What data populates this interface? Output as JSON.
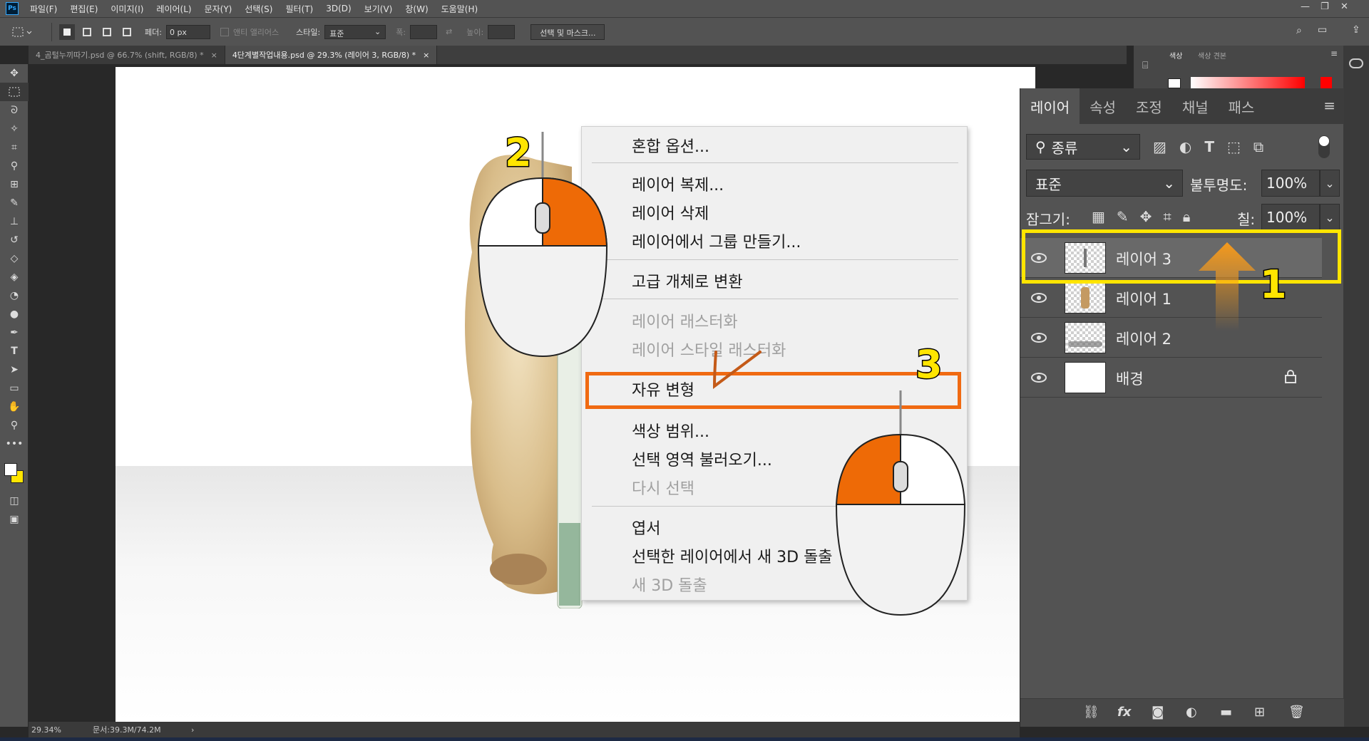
{
  "menubar": {
    "app_icon": "Ps",
    "items": [
      "파일(F)",
      "편집(E)",
      "이미지(I)",
      "레이어(L)",
      "문자(Y)",
      "선택(S)",
      "필터(T)",
      "3D(D)",
      "보기(V)",
      "창(W)",
      "도움말(H)"
    ]
  },
  "options": {
    "feather_label": "페더:",
    "feather_value": "0 px",
    "antialias_label": "앤티 앨리어스",
    "style_label": "스타일:",
    "style_value": "표준",
    "width_label": "폭:",
    "height_label": "높이:",
    "select_mask_button": "선택 및 마스크..."
  },
  "tabs": [
    {
      "label": "4_곰털누끼따기.psd @ 66.7% (shift, RGB/8) *",
      "close": "×"
    },
    {
      "label": "4단계별작업내용.psd @ 29.3% (레이어 3, RGB/8) *",
      "close": "×"
    }
  ],
  "status": {
    "zoom": "29.34%",
    "doc": "문서:39.3M/74.2M",
    "arrow": "›"
  },
  "color_panel": {
    "tab_color": "색상",
    "tab_swatches": "색상 견본"
  },
  "context_menu": {
    "items": [
      {
        "label": "혼합 옵션...",
        "disabled": false
      },
      {
        "label": "레이어 복제...",
        "disabled": false
      },
      {
        "label": "레이어 삭제",
        "disabled": false
      },
      {
        "label": "레이어에서 그룹 만들기...",
        "disabled": false
      },
      {
        "label": "고급 개체로 변환",
        "disabled": false
      },
      {
        "label": "레이어 래스터화",
        "disabled": true
      },
      {
        "label": "레이어 스타일 래스터화",
        "disabled": true
      },
      {
        "label": "자유 변형",
        "disabled": false
      },
      {
        "label": "색상 범위...",
        "disabled": false
      },
      {
        "label": "선택 영역 불러오기...",
        "disabled": false
      },
      {
        "label": "다시 선택",
        "disabled": true
      },
      {
        "label": "엽서",
        "disabled": false
      },
      {
        "label": "선택한 레이어에서 새 3D 돌출",
        "disabled": false
      },
      {
        "label": "새 3D 돌출",
        "disabled": true
      }
    ]
  },
  "layers_panel": {
    "tabs": [
      "레이어",
      "속성",
      "조정",
      "채널",
      "패스"
    ],
    "filter_label": "종류",
    "blend_mode": "표준",
    "opacity_label": "불투명도:",
    "opacity_value": "100%",
    "lock_label": "잠그기:",
    "fill_label": "칠:",
    "fill_value": "100%",
    "layers": [
      {
        "name": "레이어 3",
        "selected": true
      },
      {
        "name": "레이어 1",
        "selected": false
      },
      {
        "name": "레이어 2",
        "selected": false
      },
      {
        "name": "배경",
        "selected": false,
        "locked": true
      }
    ]
  },
  "annotations": {
    "step1": "1",
    "step2": "2",
    "step3": "3"
  },
  "colors": {
    "accent_orange": "#f06a12",
    "highlight_yellow": "#ffe500",
    "fg_color": "#ffffff",
    "bg_color": "#ffe500"
  }
}
